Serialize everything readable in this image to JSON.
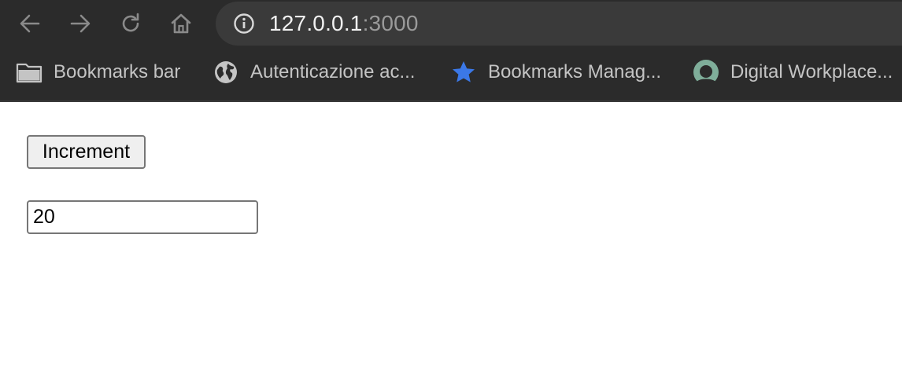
{
  "browser": {
    "toolbar": {
      "back_icon": "arrow-left-icon",
      "forward_icon": "arrow-right-icon",
      "reload_icon": "reload-icon",
      "home_icon": "home-icon",
      "site_info_icon": "info-circle-icon"
    },
    "omnibox": {
      "host": "127.0.0.1",
      "port": ":3000"
    },
    "bookmarks": [
      {
        "label": "Bookmarks bar",
        "icon": "folder-icon"
      },
      {
        "label": "Autenticazione ac...",
        "icon": "globe-icon"
      },
      {
        "label": "Bookmarks Manag...",
        "icon": "star-icon"
      },
      {
        "label": "Digital Workplace...",
        "icon": "circle-logo-icon"
      }
    ]
  },
  "page": {
    "increment_label": "Increment",
    "counter_value": "20"
  },
  "colors": {
    "chrome_bg": "#2b2b2b",
    "omnibox_bg": "#3a3a3a",
    "star_blue": "#3b78e7",
    "logo_green": "#7fae9a"
  }
}
